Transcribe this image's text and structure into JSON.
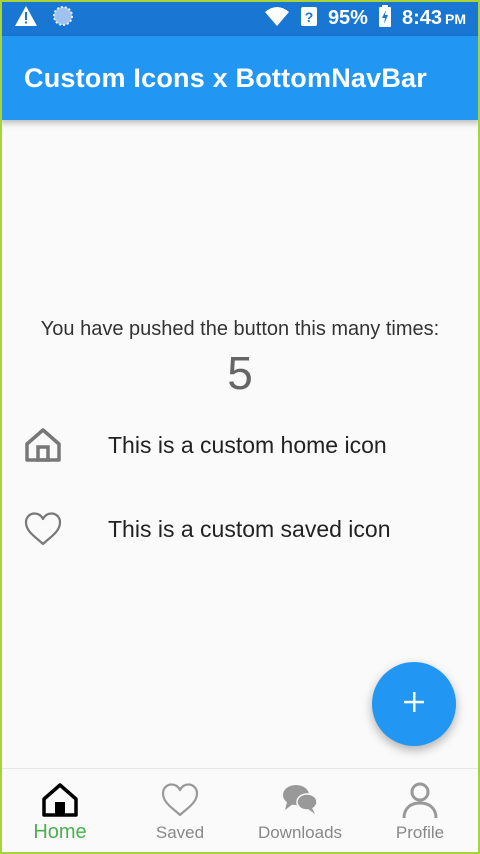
{
  "status": {
    "battery": "95%",
    "time": "8:43",
    "ampm": "PM",
    "icons": [
      "warning-icon",
      "sync-icon",
      "wifi-icon",
      "signal-question-icon",
      "battery-charging-icon"
    ]
  },
  "app_bar": {
    "title": "Custom Icons x BottomNavBar"
  },
  "main": {
    "counter_label": "You have pushed the button this many times:",
    "counter_value": "5",
    "rows": [
      {
        "icon": "home-icon",
        "text": "This is a custom home icon"
      },
      {
        "icon": "heart-icon",
        "text": "This is a custom saved icon"
      }
    ]
  },
  "fab": {
    "icon": "plus-icon"
  },
  "bottom_nav": {
    "items": [
      {
        "label": "Home",
        "icon": "home-icon",
        "active": true
      },
      {
        "label": "Saved",
        "icon": "heart-icon",
        "active": false
      },
      {
        "label": "Downloads",
        "icon": "chat-bubbles-icon",
        "active": false
      },
      {
        "label": "Profile",
        "icon": "person-icon",
        "active": false
      }
    ]
  },
  "colors": {
    "primary": "#2196f3",
    "status_bar": "#1976d2",
    "active_nav": "#4caf50",
    "inactive_nav": "#888888"
  }
}
